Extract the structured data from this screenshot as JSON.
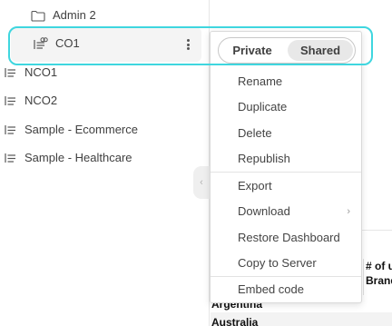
{
  "sidebar": {
    "items": [
      {
        "label": "Admin 2",
        "icon": "folder-icon"
      },
      {
        "label": "CO1",
        "icon": "shared-dashboard-icon"
      },
      {
        "label": "NCO1",
        "icon": "dashboard-icon"
      },
      {
        "label": "NCO2",
        "icon": "dashboard-icon"
      },
      {
        "label": "Sample - Ecommerce",
        "icon": "dashboard-icon"
      },
      {
        "label": "Sample - Healthcare",
        "icon": "dashboard-icon"
      }
    ],
    "selected_index": 1
  },
  "context_menu": {
    "toggle": {
      "private_label": "Private",
      "shared_label": "Shared",
      "active": "Shared"
    },
    "items": [
      {
        "label": "Rename"
      },
      {
        "label": "Duplicate"
      },
      {
        "label": "Delete"
      },
      {
        "label": "Republish"
      },
      {
        "label": "Export"
      },
      {
        "label": "Download",
        "submenu": true
      },
      {
        "label": "Restore Dashboard"
      },
      {
        "label": "Copy to Server"
      },
      {
        "label": "Embed code"
      }
    ]
  },
  "background_table": {
    "header_partial": "# of u",
    "header_partial_line2": "Brand",
    "rows_partial": [
      "Argentina",
      "Australia"
    ]
  },
  "colors": {
    "highlight": "#3fd6df",
    "toggle_active_bg": "#e8e8e8",
    "text": "#404040"
  }
}
